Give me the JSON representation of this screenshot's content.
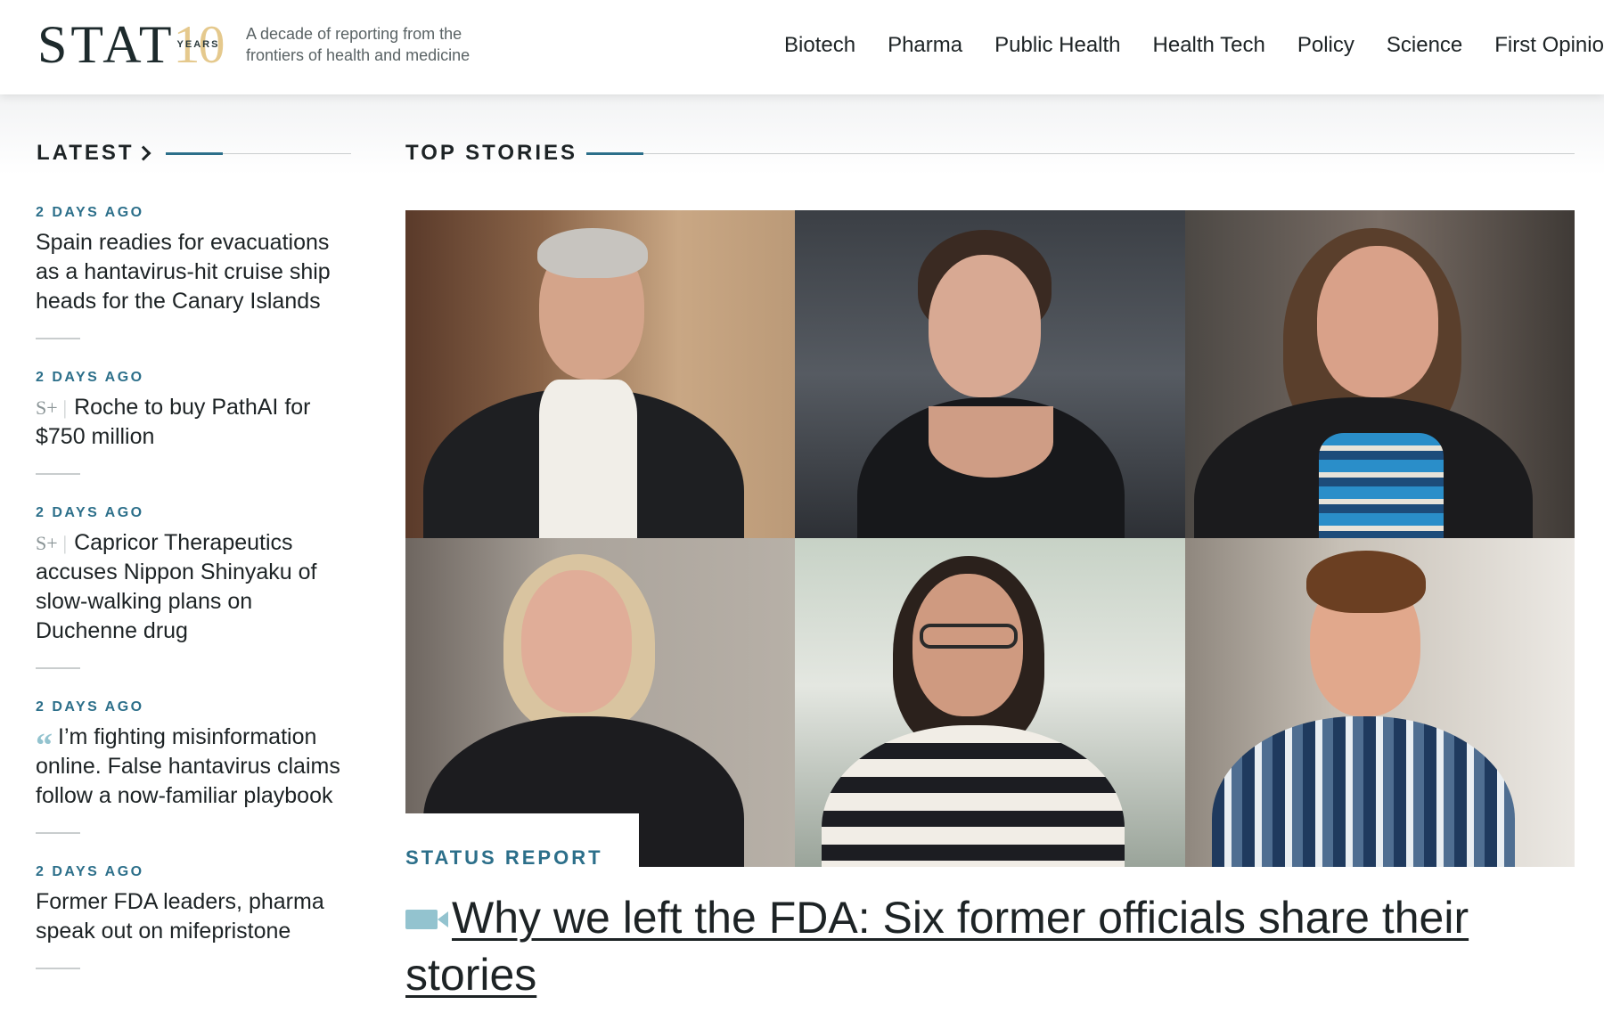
{
  "header": {
    "logo_text": "STAT",
    "logo_ten": "10",
    "logo_years": "YEARS",
    "tagline": "A decade of reporting from the frontiers of health and medicine",
    "nav": [
      "Biotech",
      "Pharma",
      "Public Health",
      "Health Tech",
      "Policy",
      "Science",
      "First Opinion"
    ]
  },
  "latest": {
    "title": "LATEST",
    "items": [
      {
        "time": "2 DAYS AGO",
        "title": "Spain readies for evacuations as a hantavirus-hit cruise ship heads for the Canary Islands",
        "badge": ""
      },
      {
        "time": "2 DAYS AGO",
        "title": "Roche to buy PathAI for $750 million",
        "badge": "S+"
      },
      {
        "time": "2 DAYS AGO",
        "title": "Capricor Therapeutics accuses Nippon Shinyaku of slow-walking plans on Duchenne drug",
        "badge": "S+"
      },
      {
        "time": "2 DAYS AGO",
        "title": "I’m fighting misinformation online. False hantavirus claims follow a now-familiar playbook",
        "badge": "quote"
      },
      {
        "time": "2 DAYS AGO",
        "title": "Former FDA leaders, pharma speak out on mifepristone",
        "badge": ""
      }
    ]
  },
  "top_stories": {
    "title": "TOP STORIES",
    "label": "STATUS REPORT",
    "headline": "Why we left the FDA: Six former officials share their stories",
    "media": "video-icon"
  },
  "colors": {
    "accent": "#2c6f8a",
    "icon_light": "#93c3cf",
    "logo_gold": "#e5c98d",
    "text": "#1d2325"
  }
}
